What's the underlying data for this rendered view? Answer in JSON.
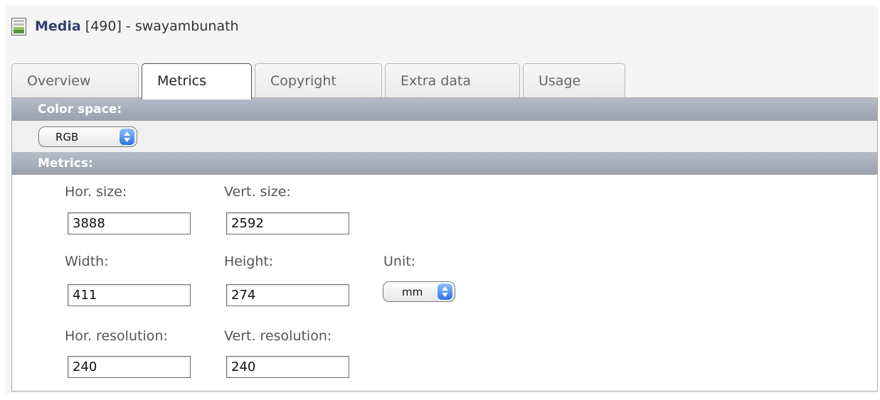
{
  "header": {
    "type_label": "Media",
    "id_text": "[490]",
    "separator": "-",
    "name": "swayambunath"
  },
  "tabs": [
    {
      "label": "Overview",
      "active": false
    },
    {
      "label": "Metrics",
      "active": true
    },
    {
      "label": "Copyright",
      "active": false
    },
    {
      "label": "Extra data",
      "active": false
    },
    {
      "label": "Usage",
      "active": false
    }
  ],
  "color_space": {
    "section_label": "Color space:",
    "selected": "RGB"
  },
  "metrics": {
    "section_label": "Metrics:",
    "hor_size_label": "Hor. size:",
    "hor_size_value": "3888",
    "vert_size_label": "Vert. size:",
    "vert_size_value": "2592",
    "width_label": "Width:",
    "width_value": "411",
    "height_label": "Height:",
    "height_value": "274",
    "unit_label": "Unit:",
    "unit_value": "mm",
    "hor_res_label": "Hor. resolution:",
    "hor_res_value": "240",
    "vert_res_label": "Vert. resolution:",
    "vert_res_value": "240"
  },
  "colors": {
    "title_accent": "#2f3f6e",
    "section_bar": "#a5adb9",
    "select_arrow": "#3b7ff0"
  }
}
